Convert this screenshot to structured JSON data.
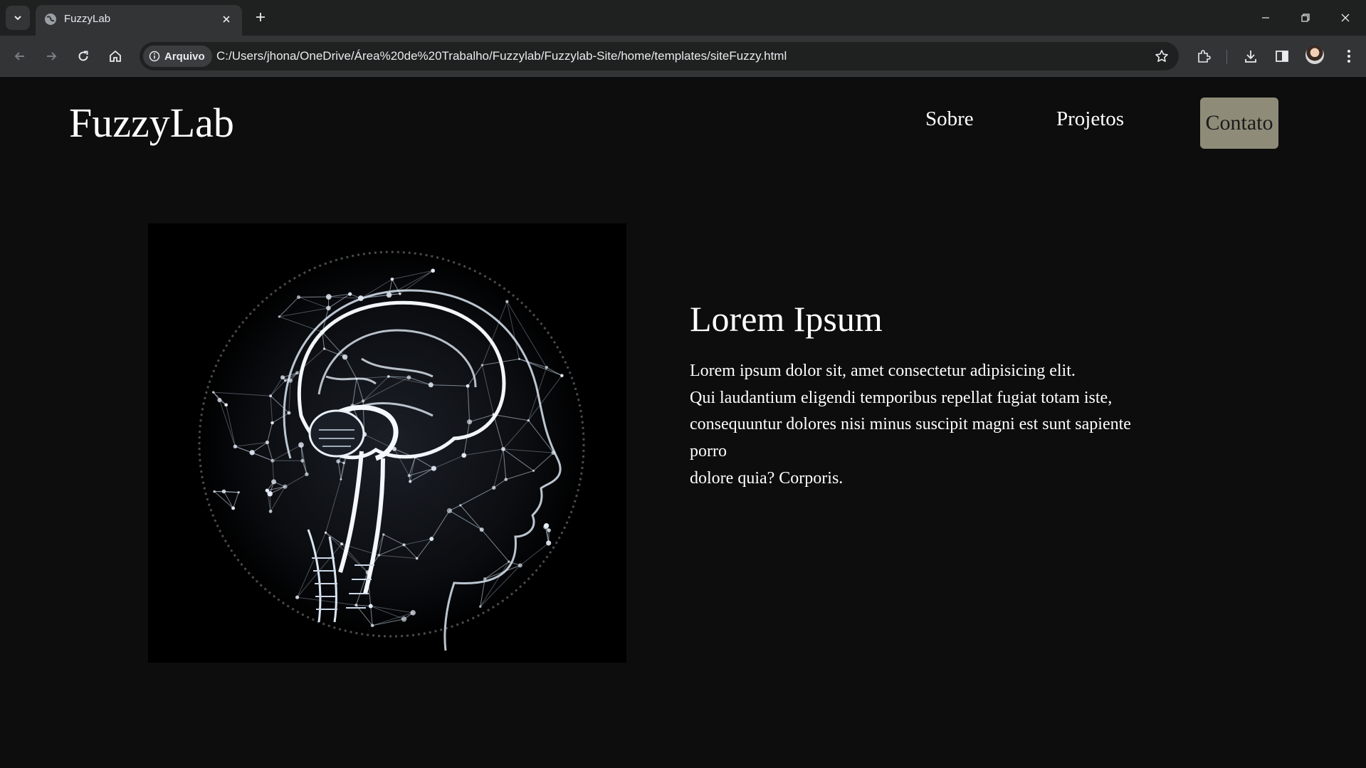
{
  "browser": {
    "tab_title": "FuzzyLab",
    "security_chip": "Arquivo",
    "url": "C:/Users/jhona/OneDrive/Área%20de%20Trabalho/Fuzzylab/Fuzzylab-Site/home/templates/siteFuzzy.html"
  },
  "header": {
    "brand": "FuzzyLab",
    "nav": [
      {
        "label": "Sobre"
      },
      {
        "label": "Projetos"
      }
    ],
    "contact_label": "Contato",
    "contact_color": "#8e8c78"
  },
  "hero": {
    "title": "Lorem Ipsum",
    "lines": [
      "Lorem ipsum dolor sit, amet consectetur adipisicing elit.",
      "Qui laudantium eligendi temporibus repellat fugiat totam iste,",
      "consequuntur dolores nisi minus suscipit magni est sunt sapiente",
      "porro",
      "dolore quia? Corporis."
    ],
    "image_icon": "brain-network-illustration"
  }
}
